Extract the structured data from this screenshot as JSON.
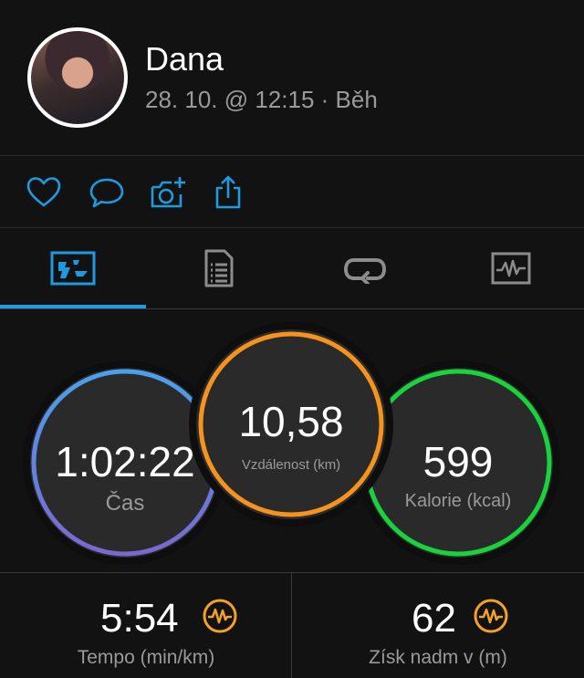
{
  "user": {
    "name": "Dana",
    "meta": "28. 10. @ 12:15 · Běh"
  },
  "actions": {
    "icons": [
      "heart-icon",
      "comment-icon",
      "camera-plus-icon",
      "share-icon"
    ]
  },
  "tabs": [
    {
      "icon": "map-stats-icon",
      "active": true
    },
    {
      "icon": "document-list-icon",
      "active": false
    },
    {
      "icon": "repeat-laps-icon",
      "active": false
    },
    {
      "icon": "graph-chart-icon",
      "active": false
    }
  ],
  "colors": {
    "accent": "#1e9be0",
    "time_ring": "#5a8fe6",
    "time_ring_2": "#7b6bd0",
    "distance_ring": "#f5931e",
    "calories_ring": "#19d23c",
    "badge": "#f2a322"
  },
  "stats": {
    "time": {
      "value": "1:02:22",
      "label": "Čas"
    },
    "distance": {
      "value": "10,58",
      "label": "Vzdálenost (km)"
    },
    "calories": {
      "value": "599",
      "label": "Kalorie (kcal)"
    }
  },
  "metrics": [
    {
      "value": "5:54",
      "label": "Tempo (min/km)",
      "badge": "heart-rate-icon"
    },
    {
      "value": "62",
      "label": "Získ nadm v (m)",
      "badge": "heart-rate-icon"
    }
  ]
}
